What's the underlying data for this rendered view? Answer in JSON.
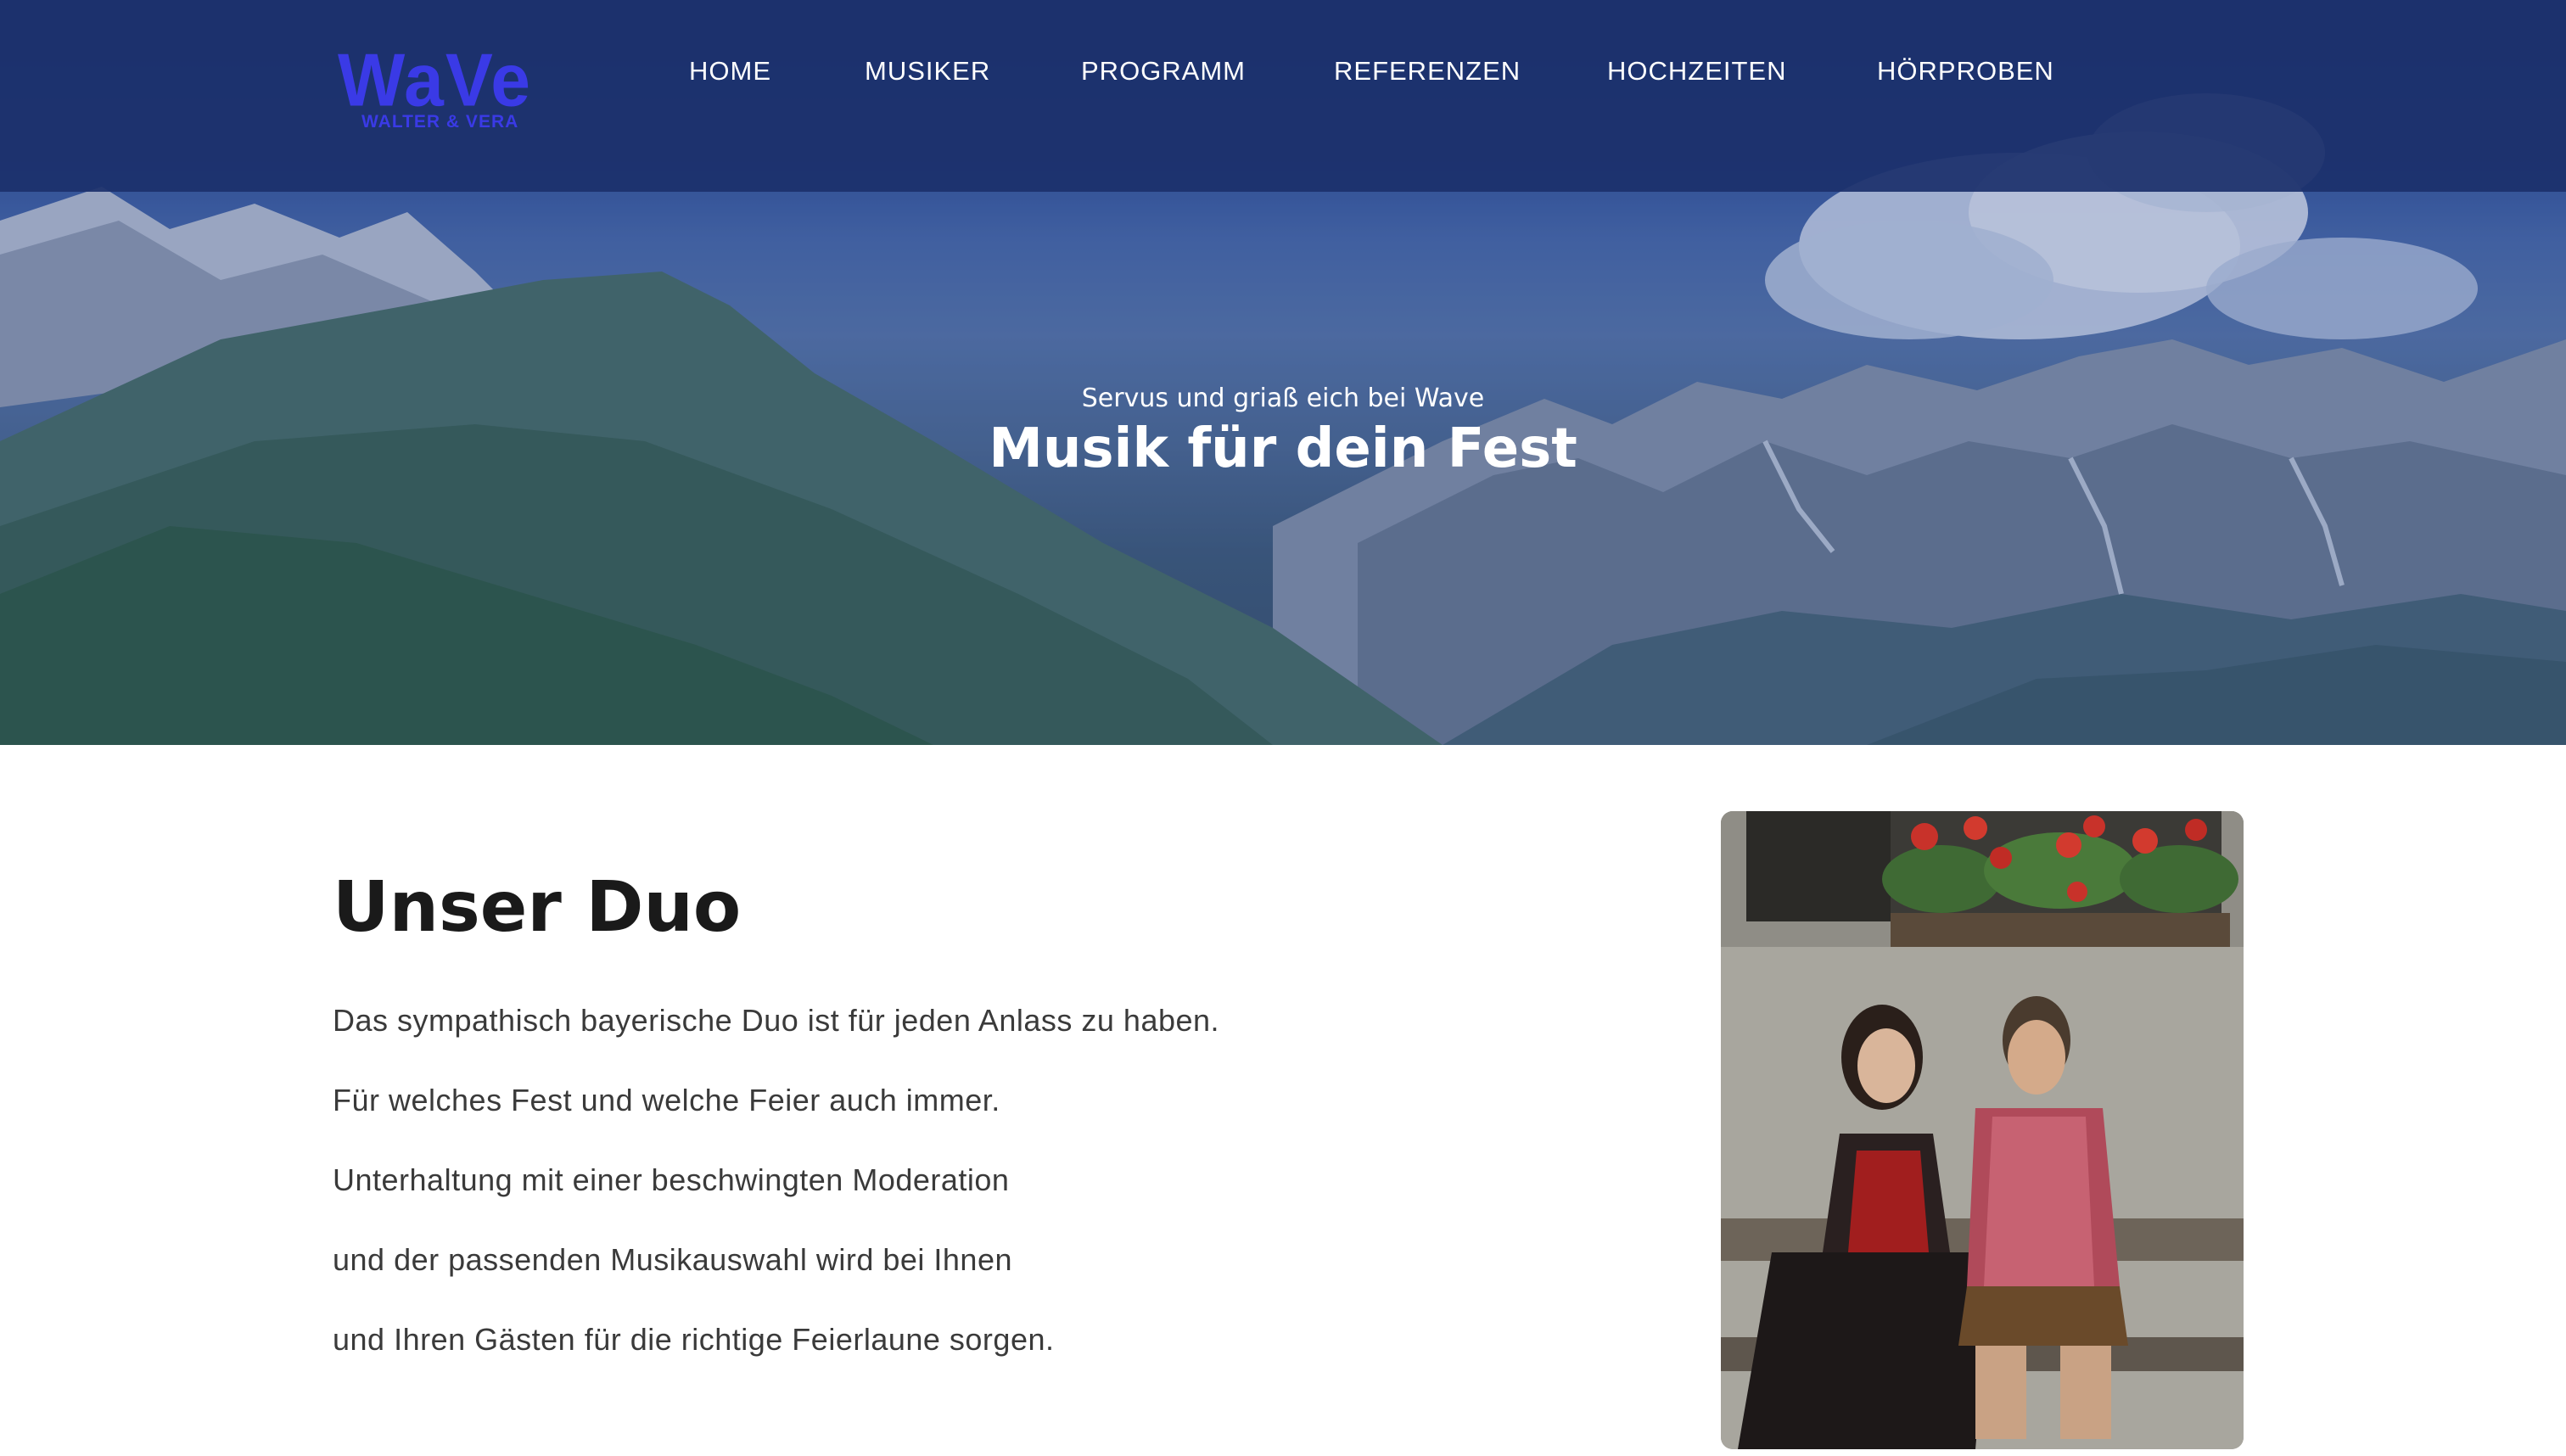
{
  "brand": {
    "logo_word": "WaVe",
    "logo_sub": "WALTER & VERA",
    "logo_color": "#3a3ae6"
  },
  "nav": {
    "items": [
      {
        "label": "HOME"
      },
      {
        "label": "MUSIKER"
      },
      {
        "label": "PROGRAMM"
      },
      {
        "label": "REFERENZEN"
      },
      {
        "label": "HOCHZEITEN"
      },
      {
        "label": "HÖRPROBEN"
      }
    ]
  },
  "hero": {
    "subtitle": "Servus und griaß eich bei Wave",
    "title": "Musik für dein Fest"
  },
  "section": {
    "title": "Unser Duo",
    "paragraphs": [
      "Das sympathisch bayerische Duo ist für jeden Anlass zu haben.",
      "Für welches Fest und welche Feier auch immer.",
      "Unterhaltung mit einer beschwingten Moderation",
      "und der passenden Musikauswahl wird bei Ihnen",
      "und Ihren Gästen für die richtige Feierlaune sorgen."
    ]
  },
  "colors": {
    "navbar_bg": "#1c306c",
    "text_dark": "#1a1a1a",
    "text_body": "#3a3a3a"
  }
}
